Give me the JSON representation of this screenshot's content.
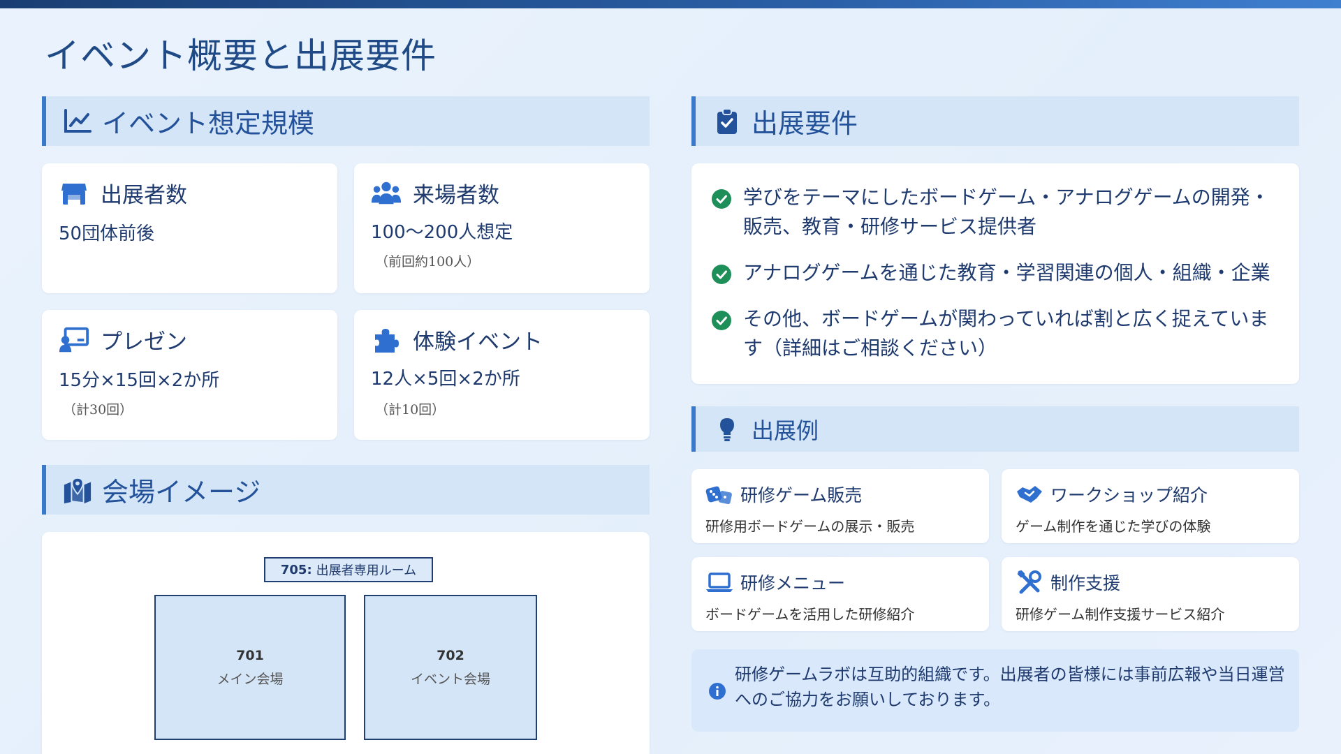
{
  "page": {
    "title": "イベント概要と出展要件"
  },
  "scale": {
    "title": "イベント想定規模",
    "stats": [
      {
        "label": "出展者数",
        "value": "50団体前後",
        "note": ""
      },
      {
        "label": "来場者数",
        "value": "100〜200人想定",
        "note": "（前回約100人）"
      },
      {
        "label": "プレゼン",
        "value": "15分×15回×2か所",
        "note": "（計30回）"
      },
      {
        "label": "体験イベント",
        "value": "12人×5回×2か所",
        "note": "（計10回）"
      }
    ]
  },
  "venue": {
    "title": "会場イメージ",
    "rooms": [
      {
        "number": "705:",
        "name": "出展者専用ルーム"
      },
      {
        "number": "701",
        "name": "メイン会場"
      },
      {
        "number": "702",
        "name": "イベント会場"
      }
    ]
  },
  "requirements": {
    "title": "出展要件",
    "items": [
      "学びをテーマにしたボードゲーム・アナログゲームの開発・販売、教育・研修サービス提供者",
      "アナログゲームを通じた教育・学習関連の個人・組織・企業",
      "その他、ボードゲームが関わっていれば割と広く捉えています（詳細はご相談ください）"
    ]
  },
  "examples": {
    "title": "出展例",
    "items": [
      {
        "title": "研修ゲーム販売",
        "desc": "研修用ボードゲームの展示・販売",
        "icon": "dice-icon"
      },
      {
        "title": "ワークショップ紹介",
        "desc": "ゲーム制作を通じた学びの体験",
        "icon": "handshake-icon"
      },
      {
        "title": "研修メニュー",
        "desc": "ボードゲームを活用した研修紹介",
        "icon": "laptop-icon"
      },
      {
        "title": "制作支援",
        "desc": "研修ゲーム制作支援サービス紹介",
        "icon": "tools-icon"
      }
    ]
  },
  "note": {
    "text": "研修ゲームラボは互助的組織です。出展者の皆様には事前広報や当日運営へのご協力をお願いしております。"
  },
  "colors": {
    "accent": "#2f6fcf",
    "check": "#1f8f5a",
    "header_bg": "#d4e5f8",
    "title": "#1f4a86"
  }
}
